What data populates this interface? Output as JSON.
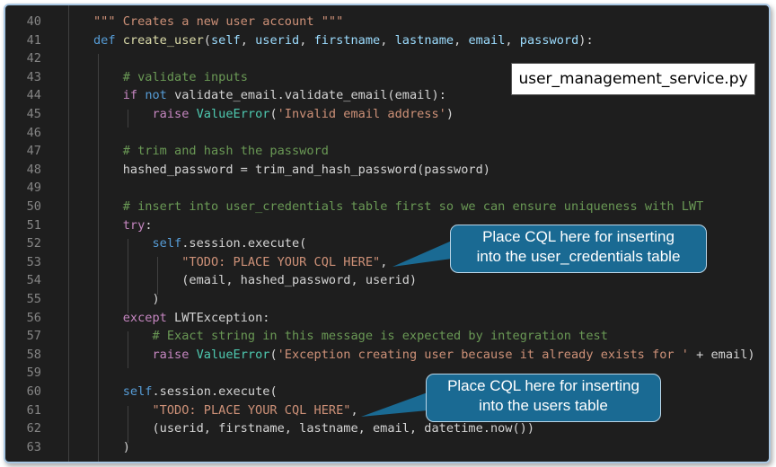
{
  "file_label": "user_management_service.py",
  "callouts": {
    "cred_line1": "Place CQL here for inserting",
    "cred_line2": "into the user_credentials table",
    "users_line1": "Place CQL here for inserting",
    "users_line2": "into the users table"
  },
  "lines": [
    {
      "n": "40",
      "t": [
        [
          "str",
          "\"\"\" Creates a new user account \"\"\""
        ]
      ]
    },
    {
      "n": "41",
      "t": [
        [
          "kw",
          "def "
        ],
        [
          "fn",
          "create_user"
        ],
        [
          "plain",
          "("
        ],
        [
          "param",
          "self"
        ],
        [
          "plain",
          ", "
        ],
        [
          "param",
          "userid"
        ],
        [
          "plain",
          ", "
        ],
        [
          "param",
          "firstname"
        ],
        [
          "plain",
          ", "
        ],
        [
          "param",
          "lastname"
        ],
        [
          "plain",
          ", "
        ],
        [
          "param",
          "email"
        ],
        [
          "plain",
          ", "
        ],
        [
          "param",
          "password"
        ],
        [
          "plain",
          "):"
        ]
      ]
    },
    {
      "n": "42",
      "t": []
    },
    {
      "n": "43",
      "t": [
        [
          "plain",
          "    "
        ],
        [
          "cm",
          "# validate inputs"
        ]
      ]
    },
    {
      "n": "44",
      "t": [
        [
          "plain",
          "    "
        ],
        [
          "kw2",
          "if "
        ],
        [
          "kw",
          "not "
        ],
        [
          "plain",
          "validate_email.validate_email(email):"
        ]
      ]
    },
    {
      "n": "45",
      "t": [
        [
          "plain",
          "        "
        ],
        [
          "kw2",
          "raise "
        ],
        [
          "cls",
          "ValueError"
        ],
        [
          "plain",
          "("
        ],
        [
          "str",
          "'Invalid email address'"
        ],
        [
          "plain",
          ")"
        ]
      ]
    },
    {
      "n": "46",
      "t": []
    },
    {
      "n": "47",
      "t": [
        [
          "plain",
          "    "
        ],
        [
          "cm",
          "# trim and hash the password"
        ]
      ]
    },
    {
      "n": "48",
      "t": [
        [
          "plain",
          "    hashed_password = trim_and_hash_password(password)"
        ]
      ]
    },
    {
      "n": "49",
      "t": []
    },
    {
      "n": "50",
      "t": [
        [
          "plain",
          "    "
        ],
        [
          "cm",
          "# insert into user_credentials table first so we can ensure uniqueness with LWT"
        ]
      ]
    },
    {
      "n": "51",
      "t": [
        [
          "plain",
          "    "
        ],
        [
          "kw2",
          "try"
        ],
        [
          "plain",
          ":"
        ]
      ]
    },
    {
      "n": "52",
      "t": [
        [
          "plain",
          "        "
        ],
        [
          "kw",
          "self"
        ],
        [
          "plain",
          ".session.execute("
        ]
      ]
    },
    {
      "n": "53",
      "t": [
        [
          "plain",
          "            "
        ],
        [
          "str",
          "\"TODO: PLACE YOUR CQL HERE\""
        ],
        [
          "plain",
          ","
        ]
      ]
    },
    {
      "n": "54",
      "t": [
        [
          "plain",
          "            (email, hashed_password, userid)"
        ]
      ]
    },
    {
      "n": "55",
      "t": [
        [
          "plain",
          "        )"
        ]
      ]
    },
    {
      "n": "56",
      "t": [
        [
          "plain",
          "    "
        ],
        [
          "kw2",
          "except "
        ],
        [
          "plain",
          "LWTException:"
        ]
      ]
    },
    {
      "n": "57",
      "t": [
        [
          "plain",
          "        "
        ],
        [
          "cm",
          "# Exact string in this message is expected by integration test"
        ]
      ]
    },
    {
      "n": "58",
      "t": [
        [
          "plain",
          "        "
        ],
        [
          "kw2",
          "raise "
        ],
        [
          "cls",
          "ValueError"
        ],
        [
          "plain",
          "("
        ],
        [
          "str",
          "'Exception creating user because it already exists for '"
        ],
        [
          "plain",
          " + email)"
        ]
      ]
    },
    {
      "n": "59",
      "t": []
    },
    {
      "n": "60",
      "t": [
        [
          "plain",
          "    "
        ],
        [
          "kw",
          "self"
        ],
        [
          "plain",
          ".session.execute("
        ]
      ]
    },
    {
      "n": "61",
      "t": [
        [
          "plain",
          "        "
        ],
        [
          "str",
          "\"TODO: PLACE YOUR CQL HERE\""
        ],
        [
          "plain",
          ","
        ]
      ]
    },
    {
      "n": "62",
      "t": [
        [
          "plain",
          "        (userid, firstname, lastname, email, datetime.now())"
        ]
      ]
    },
    {
      "n": "63",
      "t": [
        [
          "plain",
          "    )"
        ]
      ]
    }
  ]
}
